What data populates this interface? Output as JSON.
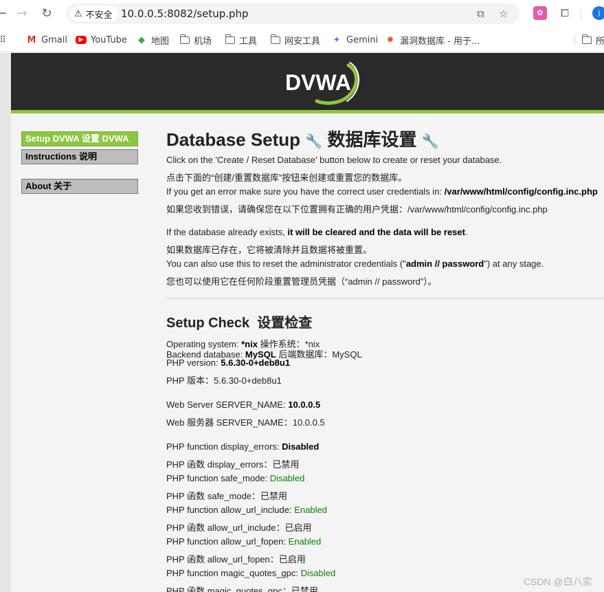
{
  "browser": {
    "security_label": "不安全",
    "url": "10.0.0.5:8082/setup.php",
    "bookmarks": [
      "Gmail",
      "YouTube",
      "地图",
      "机场",
      "工具",
      "网安工具",
      "Gemini",
      "漏洞数据库 - 用于...",
      "所"
    ],
    "profile_initial": "j"
  },
  "sidebar": {
    "items": [
      {
        "label": "Setup DVWA  设置 DVWA",
        "selected": true
      },
      {
        "label": "Instructions  说明",
        "selected": false
      },
      {
        "label": "About  关于",
        "selected": false
      }
    ]
  },
  "logo": {
    "text": "DVWA",
    "accent": "#8dc63f"
  },
  "db_setup": {
    "title": "Database Setup",
    "title_cn": "数据库设置",
    "p1_l1": "Click on the 'Create / Reset Database' button below to create or reset your database.",
    "p1_l2": "点击下面的“创建/重置数据库”按钮来创建或重置您的数据库。",
    "p1_l3_prefix": "If you get an error make sure you have the correct user credentials in: ",
    "p1_l3_path": "/var/www/html/config/config.inc.php",
    "p1_l4": "如果您收到错误，请确保您在以下位置拥有正确的用户凭据：/var/www/html/config/config.inc.php",
    "p2_l1_prefix": "If the database already exists, ",
    "p2_l1_bold": "it will be cleared and the data will be reset",
    "p2_l1_suffix": ".",
    "p2_l2": "如果数据库已存在，它将被清除并且数据将被重置。",
    "p2_l3_prefix": "You can also use this to reset the administrator credentials (\"",
    "p2_l3_bold": "admin // password",
    "p2_l3_suffix": "\") at any stage.",
    "p2_l4": "您也可以使用它在任何阶段重置管理员凭据（“admin // password”）。"
  },
  "setup_check": {
    "title": "Setup Check",
    "title_cn": "设置检查",
    "os_label": "Operating system: ",
    "os_value": "*nix",
    "os_cn": "  操作系统：*nix",
    "db_label": "Backend database: ",
    "db_value": "MySQL",
    "db_cn": "  后端数据库：MySQL",
    "php_label": "PHP version: ",
    "php_value": "5.6.30-0+deb8u1",
    "php_cn": "PHP 版本：5.6.30-0+deb8u1",
    "srv_label": "Web Server SERVER_NAME: ",
    "srv_value": "10.0.0.5",
    "srv_cn": "Web 服务器 SERVER_NAME：10.0.0.5",
    "de_label": "PHP function display_errors: ",
    "de_value": "Disabled",
    "de_cn": "PHP 函数 display_errors：已禁用",
    "sm_label": "PHP function safe_mode: ",
    "sm_value": "Disabled",
    "sm_cn": "PHP 函数 safe_mode：已禁用",
    "aui_label": "PHP function allow_url_include: ",
    "aui_value": "Enabled",
    "aui_cn": "PHP 函数 allow_url_include：已启用",
    "auf_label": "PHP function allow_url_fopen: ",
    "auf_value": "Enabled",
    "auf_cn": "PHP 函数 allow_url_fopen：已启用",
    "mq_label": "PHP function magic_quotes_gpc: ",
    "mq_value": "Disabled",
    "mq_cn": "PHP 函数 magic_quotes_gpc：已禁用"
  },
  "watermark": "CSDN @白八实"
}
